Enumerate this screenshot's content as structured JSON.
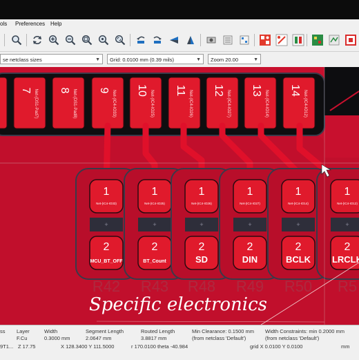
{
  "menu": {
    "items": [
      "ols",
      "Preferences",
      "Help"
    ]
  },
  "options": {
    "track_width": "se netclass sizes",
    "grid": "Grid: 0.0100 mm (0.39 mils)",
    "zoom": "Zoom 20.00"
  },
  "toolbar": {
    "icons": [
      "search-icon",
      "refresh-icon",
      "zoom-in-icon",
      "zoom-out-icon",
      "zoom-fit-icon",
      "zoom-objects-icon",
      "zoom-selection-icon",
      "rotate-ccw-icon",
      "rotate-cw-icon",
      "flip-horizontal-icon",
      "flip-vertical-icon",
      "pad-icon",
      "board-setup-icon",
      "netlist-icon",
      "drc-icon",
      "plugin-icon"
    ]
  },
  "connector_pads": [
    {
      "number": "7",
      "net": "Net-(DS1-Pad7)"
    },
    {
      "number": "8",
      "net": "Net-(DS1-Pad8)"
    },
    {
      "number": "9",
      "net": "Net-(IC4-IO33)"
    },
    {
      "number": "10",
      "net": "Net-(IC4-IO25)"
    },
    {
      "number": "11",
      "net": "Net-(IC4-IO26)"
    },
    {
      "number": "12",
      "net": "Net-(IC4-IO27)"
    },
    {
      "number": "13",
      "net": "Net-(IC4-IO14)"
    },
    {
      "number": "14",
      "net": "Net-(IC4-IO12)"
    }
  ],
  "resistors": [
    {
      "pad1": "1",
      "pad1_net": "Net-(IC4-IO33)",
      "pad2": "2",
      "pad2_net": "MCU_BT_OFF",
      "ref": "R42"
    },
    {
      "pad1": "1",
      "pad1_net": "Net-(IC4-IO25)",
      "pad2": "2",
      "pad2_net": "BT_Count",
      "ref": "R43"
    },
    {
      "pad1": "1",
      "pad1_net": "Net-(IC4-IO26)",
      "pad2": "2",
      "pad2_net": "SD",
      "ref": "R48"
    },
    {
      "pad1": "1",
      "pad1_net": "Net-(IC4-IO27)",
      "pad2": "2",
      "pad2_net": "DIN",
      "ref": "R49"
    },
    {
      "pad1": "1",
      "pad1_net": "Net-(IC4-IO14)",
      "pad2": "2",
      "pad2_net": "BCLK",
      "ref": "R50"
    },
    {
      "pad1": "1",
      "pad1_net": "Net-(IC4-IO12)",
      "pad2": "2",
      "pad2_net": "LRCLK",
      "ref": "R5"
    }
  ],
  "watermark": "Specific electronics",
  "status": {
    "col1_label": "ss",
    "col1_value": "9T1...",
    "layer_label": "Layer",
    "layer_value": "F.Cu",
    "width_label": "Width",
    "width_value": "0.3000 mm",
    "seglen_label": "Segment Length",
    "seglen_value": "2.0647 mm",
    "routed_label": "Routed Length",
    "routed_value": "3.8817 mm",
    "clearance_label": "Min Clearance: 0.1500 mm",
    "clearance_value": "(from netclass 'Default')",
    "constraint_label": "Width Constraints: min 0.2000 mm",
    "constraint_value": "(from netclass 'Default')",
    "z": "Z 17.75",
    "xy": "X 128.3400  Y 111.5000",
    "polar": "r 170.0100  theta -40.984",
    "grid": "grid X 0.0100  Y 0.0100",
    "units": "mm"
  },
  "colors": {
    "copper": "#c8102e",
    "trace": "#e0102a",
    "pad": "#e01a2c",
    "background": "#000000",
    "courtyard": "#3a3a4a"
  }
}
